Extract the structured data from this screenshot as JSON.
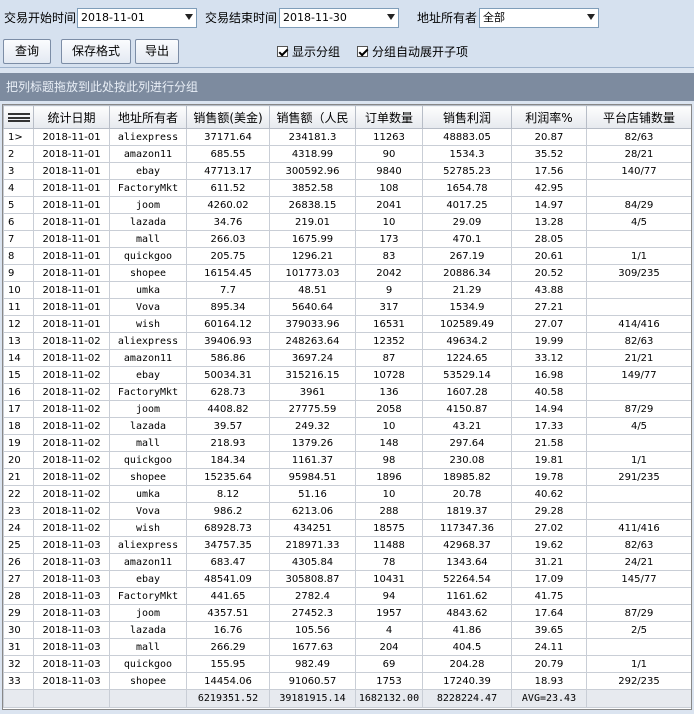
{
  "filters": {
    "start_label": "交易开始时间",
    "start_value": "2018-11-01",
    "end_label": "交易结束时间",
    "end_value": "2018-11-30",
    "owner_label": "地址所有者",
    "owner_value": "全部"
  },
  "toolbar": {
    "query_label": "查询",
    "save_format_label": "保存格式",
    "export_label": "导出",
    "show_group_label": "显示分组",
    "show_group_checked": true,
    "auto_expand_label": "分组自动展开子项",
    "auto_expand_checked": true
  },
  "group_bar": {
    "text": "把列标题拖放到此处按此列进行分组"
  },
  "table": {
    "columns": [
      "",
      "统计日期",
      "地址所有者",
      "销售额(美金)",
      "销售额（人民",
      "订单数量",
      "销售利润",
      "利润率%",
      "平台店铺数量"
    ],
    "rows": [
      [
        "1>",
        "2018-11-01",
        "aliexpress",
        "37171.64",
        "234181.3",
        "11263",
        "48883.05",
        "20.87",
        "82/63"
      ],
      [
        "2",
        "2018-11-01",
        "amazon11",
        "685.55",
        "4318.99",
        "90",
        "1534.3",
        "35.52",
        "28/21"
      ],
      [
        "3",
        "2018-11-01",
        "ebay",
        "47713.17",
        "300592.96",
        "9840",
        "52785.23",
        "17.56",
        "140/77"
      ],
      [
        "4",
        "2018-11-01",
        "FactoryMkt",
        "611.52",
        "3852.58",
        "108",
        "1654.78",
        "42.95",
        ""
      ],
      [
        "5",
        "2018-11-01",
        "joom",
        "4260.02",
        "26838.15",
        "2041",
        "4017.25",
        "14.97",
        "84/29"
      ],
      [
        "6",
        "2018-11-01",
        "lazada",
        "34.76",
        "219.01",
        "10",
        "29.09",
        "13.28",
        "4/5"
      ],
      [
        "7",
        "2018-11-01",
        "mall",
        "266.03",
        "1675.99",
        "173",
        "470.1",
        "28.05",
        ""
      ],
      [
        "8",
        "2018-11-01",
        "quickgoo",
        "205.75",
        "1296.21",
        "83",
        "267.19",
        "20.61",
        "1/1"
      ],
      [
        "9",
        "2018-11-01",
        "shopee",
        "16154.45",
        "101773.03",
        "2042",
        "20886.34",
        "20.52",
        "309/235"
      ],
      [
        "10",
        "2018-11-01",
        "umka",
        "7.7",
        "48.51",
        "9",
        "21.29",
        "43.88",
        ""
      ],
      [
        "11",
        "2018-11-01",
        "Vova",
        "895.34",
        "5640.64",
        "317",
        "1534.9",
        "27.21",
        ""
      ],
      [
        "12",
        "2018-11-01",
        "wish",
        "60164.12",
        "379033.96",
        "16531",
        "102589.49",
        "27.07",
        "414/416"
      ],
      [
        "13",
        "2018-11-02",
        "aliexpress",
        "39406.93",
        "248263.64",
        "12352",
        "49634.2",
        "19.99",
        "82/63"
      ],
      [
        "14",
        "2018-11-02",
        "amazon11",
        "586.86",
        "3697.24",
        "87",
        "1224.65",
        "33.12",
        "21/21"
      ],
      [
        "15",
        "2018-11-02",
        "ebay",
        "50034.31",
        "315216.15",
        "10728",
        "53529.14",
        "16.98",
        "149/77"
      ],
      [
        "16",
        "2018-11-02",
        "FactoryMkt",
        "628.73",
        "3961",
        "136",
        "1607.28",
        "40.58",
        ""
      ],
      [
        "17",
        "2018-11-02",
        "joom",
        "4408.82",
        "27775.59",
        "2058",
        "4150.87",
        "14.94",
        "87/29"
      ],
      [
        "18",
        "2018-11-02",
        "lazada",
        "39.57",
        "249.32",
        "10",
        "43.21",
        "17.33",
        "4/5"
      ],
      [
        "19",
        "2018-11-02",
        "mall",
        "218.93",
        "1379.26",
        "148",
        "297.64",
        "21.58",
        ""
      ],
      [
        "20",
        "2018-11-02",
        "quickgoo",
        "184.34",
        "1161.37",
        "98",
        "230.08",
        "19.81",
        "1/1"
      ],
      [
        "21",
        "2018-11-02",
        "shopee",
        "15235.64",
        "95984.51",
        "1896",
        "18985.82",
        "19.78",
        "291/235"
      ],
      [
        "22",
        "2018-11-02",
        "umka",
        "8.12",
        "51.16",
        "10",
        "20.78",
        "40.62",
        ""
      ],
      [
        "23",
        "2018-11-02",
        "Vova",
        "986.2",
        "6213.06",
        "288",
        "1819.37",
        "29.28",
        ""
      ],
      [
        "24",
        "2018-11-02",
        "wish",
        "68928.73",
        "434251",
        "18575",
        "117347.36",
        "27.02",
        "411/416"
      ],
      [
        "25",
        "2018-11-03",
        "aliexpress",
        "34757.35",
        "218971.33",
        "11488",
        "42968.37",
        "19.62",
        "82/63"
      ],
      [
        "26",
        "2018-11-03",
        "amazon11",
        "683.47",
        "4305.84",
        "78",
        "1343.64",
        "31.21",
        "24/21"
      ],
      [
        "27",
        "2018-11-03",
        "ebay",
        "48541.09",
        "305808.87",
        "10431",
        "52264.54",
        "17.09",
        "145/77"
      ],
      [
        "28",
        "2018-11-03",
        "FactoryMkt",
        "441.65",
        "2782.4",
        "94",
        "1161.62",
        "41.75",
        ""
      ],
      [
        "29",
        "2018-11-03",
        "joom",
        "4357.51",
        "27452.3",
        "1957",
        "4843.62",
        "17.64",
        "87/29"
      ],
      [
        "30",
        "2018-11-03",
        "lazada",
        "16.76",
        "105.56",
        "4",
        "41.86",
        "39.65",
        "2/5"
      ],
      [
        "31",
        "2018-11-03",
        "mall",
        "266.29",
        "1677.63",
        "204",
        "404.5",
        "24.11",
        ""
      ],
      [
        "32",
        "2018-11-03",
        "quickgoo",
        "155.95",
        "982.49",
        "69",
        "204.28",
        "20.79",
        "1/1"
      ],
      [
        "33",
        "2018-11-03",
        "shopee",
        "14454.06",
        "91060.57",
        "1753",
        "17240.39",
        "18.93",
        "292/235"
      ]
    ],
    "footer": [
      "",
      "",
      "",
      "6219351.52",
      "39181915.14",
      "1682132.00",
      "8228224.47",
      "AVG=23.43",
      ""
    ]
  }
}
